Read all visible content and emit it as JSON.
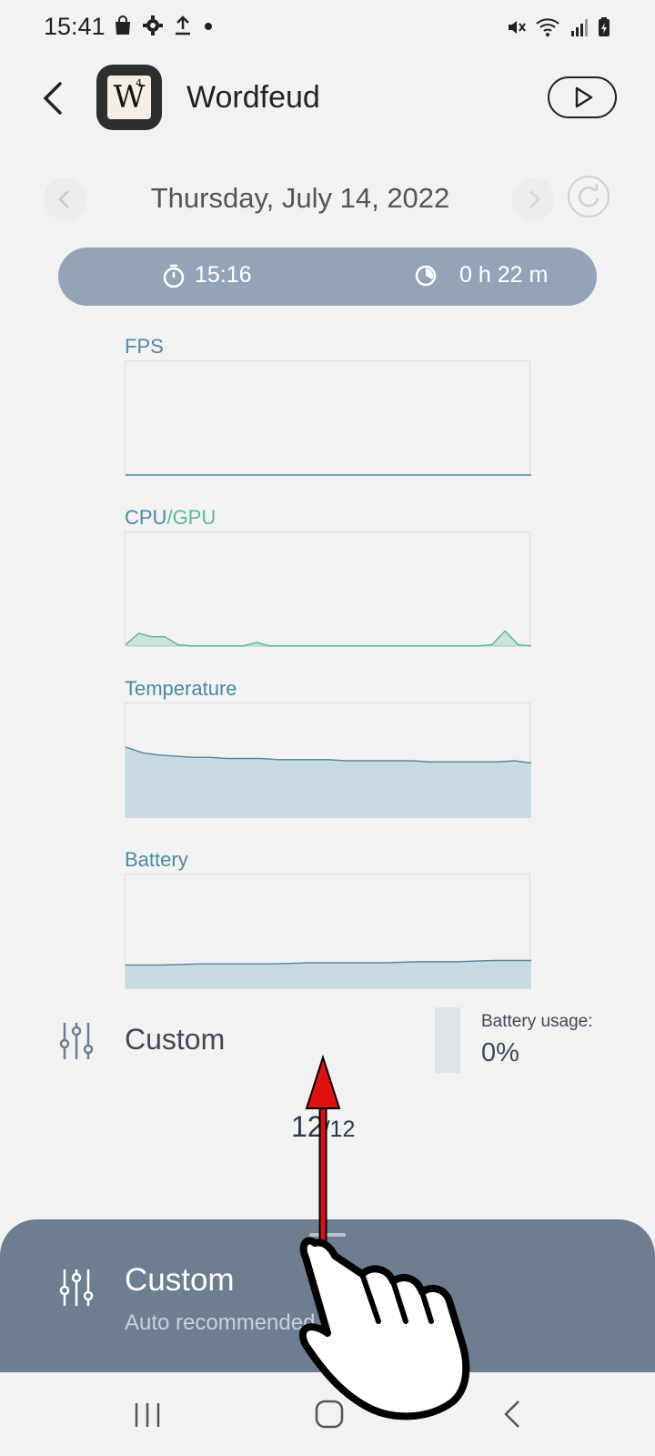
{
  "status_bar": {
    "time": "15:41",
    "left_icons": [
      "shopping-bag-icon",
      "gear-icon",
      "upload-icon",
      "dot-icon"
    ],
    "right_icons": [
      "mute-icon",
      "wifi-icon",
      "signal-icon",
      "battery-charging-icon"
    ]
  },
  "header": {
    "title": "Wordfeud",
    "app_icon_letter": "W",
    "app_icon_superscript": "4"
  },
  "date_nav": {
    "date": "Thursday, July 14, 2022"
  },
  "session": {
    "start_time": "15:16",
    "duration": "0 h 22 m"
  },
  "charts": {
    "fps_label": "FPS",
    "cpu_label": "CPU",
    "gpu_label": "/GPU",
    "temperature_label": "Temperature",
    "battery_label": "Battery"
  },
  "chart_data": [
    {
      "type": "line",
      "title": "FPS",
      "values": []
    },
    {
      "type": "area",
      "title": "CPU/GPU",
      "series": [
        {
          "name": "CPU",
          "values": [
            2,
            12,
            9,
            9,
            2,
            1,
            1,
            1,
            1,
            1,
            4,
            1,
            1,
            1,
            1,
            1,
            1,
            1,
            1,
            1,
            1,
            1,
            1,
            1,
            1,
            1,
            1,
            1,
            2,
            14,
            2,
            1
          ]
        }
      ]
    },
    {
      "type": "area",
      "title": "Temperature",
      "series": [
        {
          "name": "Temperature",
          "values": [
            62,
            57,
            55,
            54,
            53,
            53,
            52,
            52,
            52,
            51,
            51,
            51,
            51,
            50,
            50,
            50,
            50,
            50,
            49,
            49,
            49,
            49,
            49,
            50,
            48
          ]
        }
      ]
    },
    {
      "type": "area",
      "title": "Battery",
      "series": [
        {
          "name": "Battery",
          "values": [
            21,
            21,
            22,
            22,
            22,
            23,
            23,
            23,
            24,
            24,
            25,
            25
          ]
        }
      ]
    }
  ],
  "mode": {
    "label": "Custom",
    "battery_usage_label": "Battery usage:",
    "battery_usage_value": "0%"
  },
  "pager": {
    "current": "12",
    "total": "/12"
  },
  "bottom_sheet": {
    "title": "Custom",
    "subtitle": "Auto recommended"
  },
  "colors": {
    "accent_blue": "#4b8aa8",
    "gpu_green": "#5bb99e",
    "pill_bg": "#93a4b8",
    "sheet_bg": "#6d7e91"
  }
}
